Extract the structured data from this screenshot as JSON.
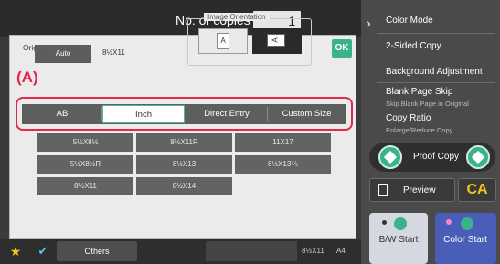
{
  "header": {
    "copies_label": "No. of copies",
    "copies_value": "1"
  },
  "dialog": {
    "title": "Original",
    "ok_label": "OK",
    "auto_label": "Auto",
    "detected_size": "8½X11",
    "orientation_label": "Image Orientation",
    "orientation_portrait_glyph": "A",
    "orientation_landscape_glyph": "A"
  },
  "callout": "(A)",
  "tabs": [
    {
      "label": "AB",
      "active": false
    },
    {
      "label": "Inch",
      "active": true
    },
    {
      "label": "Direct Entry",
      "active": false
    },
    {
      "label": "Custom Size",
      "active": false
    }
  ],
  "sizes": [
    "5½X8½",
    "8½X11R",
    "11X17",
    "5½X8½R",
    "8½X13",
    "8½X13⅖",
    "8½X11",
    "8½X14"
  ],
  "right_menu": {
    "items": [
      {
        "label": "Color Mode",
        "sub": ""
      },
      {
        "label": "2-Sided Copy",
        "sub": ""
      },
      {
        "label": "Background Adjustment",
        "sub": ""
      },
      {
        "label": "Blank Page Skip",
        "sub": "Skip Blank Page in Original"
      },
      {
        "label": "Copy Ratio",
        "sub": "Enlarge/Reduce Copy"
      }
    ],
    "proof_copy_label": "Proof Copy",
    "preview_label": "Preview",
    "ca_label": "CA",
    "bw_start_label": "B/W Start",
    "color_start_label": "Color Start"
  },
  "bottom": {
    "others_label": "Others",
    "tray_size": "8½X11",
    "tray_name": "A4"
  },
  "colors": {
    "accent_green": "#3bb38a",
    "highlight_red": "#e3264a",
    "ca_yellow": "#f2c21e",
    "color_start_blue": "#4a5db8"
  }
}
